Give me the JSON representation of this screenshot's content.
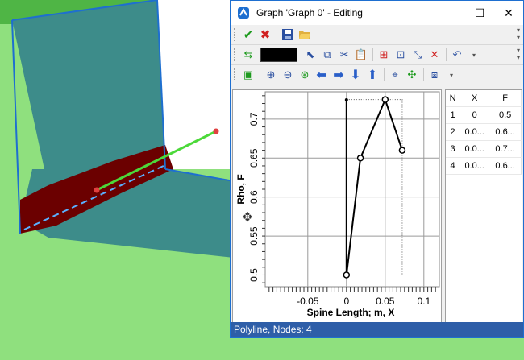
{
  "window": {
    "title": "Graph 'Graph 0' - Editing",
    "controls": {
      "minimize": "—",
      "maximize": "☐",
      "close": "✕"
    }
  },
  "toolbar1": {
    "items": [
      {
        "icon": "check-icon",
        "glyph": "✔",
        "color": "#1d9a1d"
      },
      {
        "icon": "cancel-icon",
        "glyph": "✖",
        "color": "#d02020"
      },
      {
        "icon": "save-icon",
        "glyph": "💾",
        "color": "#2a4fa0"
      },
      {
        "icon": "open-folder-icon",
        "glyph": "📂",
        "color": "#d8a020"
      }
    ]
  },
  "toolbar2": {
    "swatch_color": "#000000",
    "undo_glyph": "↶"
  },
  "graph": {
    "ylabel": "Rho, F",
    "xlabel": "Spine Length; m, X",
    "yticks": [
      "0.5",
      "0.55",
      "0.6",
      "0.65",
      "0.7"
    ],
    "xticks": [
      "-0.05",
      "0",
      "0.05",
      "0.1"
    ]
  },
  "chart_data": {
    "type": "line",
    "xlabel": "Spine Length; m, X",
    "ylabel": "Rho, F",
    "xlim": [
      -0.105,
      0.12
    ],
    "ylim": [
      0.485,
      0.735
    ],
    "series": [
      {
        "x": [
          0,
          0.018,
          0.05,
          0.072
        ],
        "y": [
          0.5,
          0.65,
          0.725,
          0.66
        ]
      }
    ]
  },
  "table": {
    "headers": [
      "N",
      "X",
      "F"
    ],
    "rows": [
      [
        "1",
        "0",
        "0.5"
      ],
      [
        "2",
        "0.0...",
        "0.6..."
      ],
      [
        "3",
        "0.0...",
        "0.7..."
      ],
      [
        "4",
        "0.0...",
        "0.6..."
      ]
    ]
  },
  "status": {
    "text": "Polyline, Nodes: 4"
  },
  "colors": {
    "accent": "#2e5ea8",
    "background_green": "#8fe07e",
    "teal_surface": "#3d8c8a",
    "dark_red_surface": "#6b0000",
    "selection_green": "#4cd93a"
  }
}
